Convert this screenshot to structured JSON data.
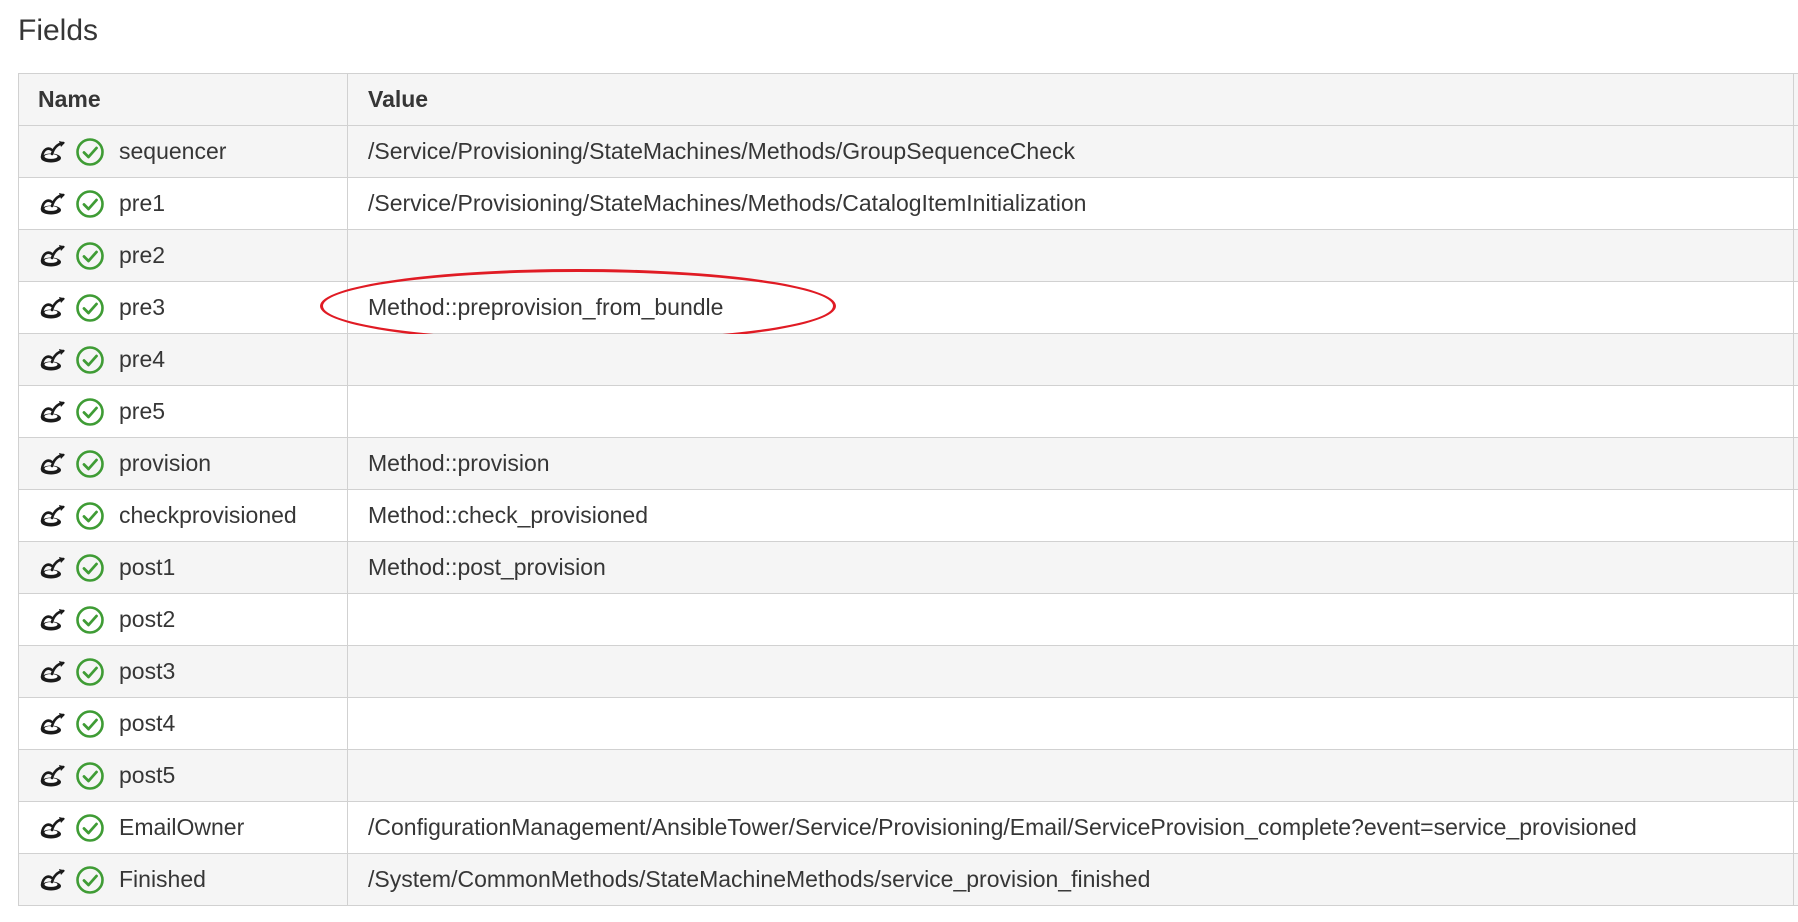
{
  "page": {
    "section_title": "Fields"
  },
  "table": {
    "headers": {
      "name": "Name",
      "value": "Value"
    },
    "rows": [
      {
        "name": "sequencer",
        "value": "/Service/Provisioning/StateMachines/Methods/GroupSequenceCheck"
      },
      {
        "name": "pre1",
        "value": "/Service/Provisioning/StateMachines/Methods/CatalogItemInitialization"
      },
      {
        "name": "pre2",
        "value": ""
      },
      {
        "name": "pre3",
        "value": "Method::preprovision_from_bundle",
        "highlighted": true
      },
      {
        "name": "pre4",
        "value": ""
      },
      {
        "name": "pre5",
        "value": ""
      },
      {
        "name": "provision",
        "value": "Method::provision"
      },
      {
        "name": "checkprovisioned",
        "value": "Method::check_provisioned"
      },
      {
        "name": "post1",
        "value": "Method::post_provision"
      },
      {
        "name": "post2",
        "value": ""
      },
      {
        "name": "post3",
        "value": ""
      },
      {
        "name": "post4",
        "value": ""
      },
      {
        "name": "post5",
        "value": ""
      },
      {
        "name": "EmailOwner",
        "value": "/ConfigurationManagement/AnsibleTower/Service/Provisioning/Email/ServiceProvision_complete?event=service_provisioned"
      },
      {
        "name": "Finished",
        "value": "/System/CommonMethods/StateMachineMethods/service_provision_finished"
      }
    ]
  },
  "icons": {
    "field_icon": "state-machine-field-icon",
    "status_icon": "check-circle-icon"
  },
  "colors": {
    "status_ok": "#3f9c35",
    "highlight_annotation": "#e01b24",
    "header_bg": "#f5f5f5",
    "border": "#d1d1d1"
  }
}
